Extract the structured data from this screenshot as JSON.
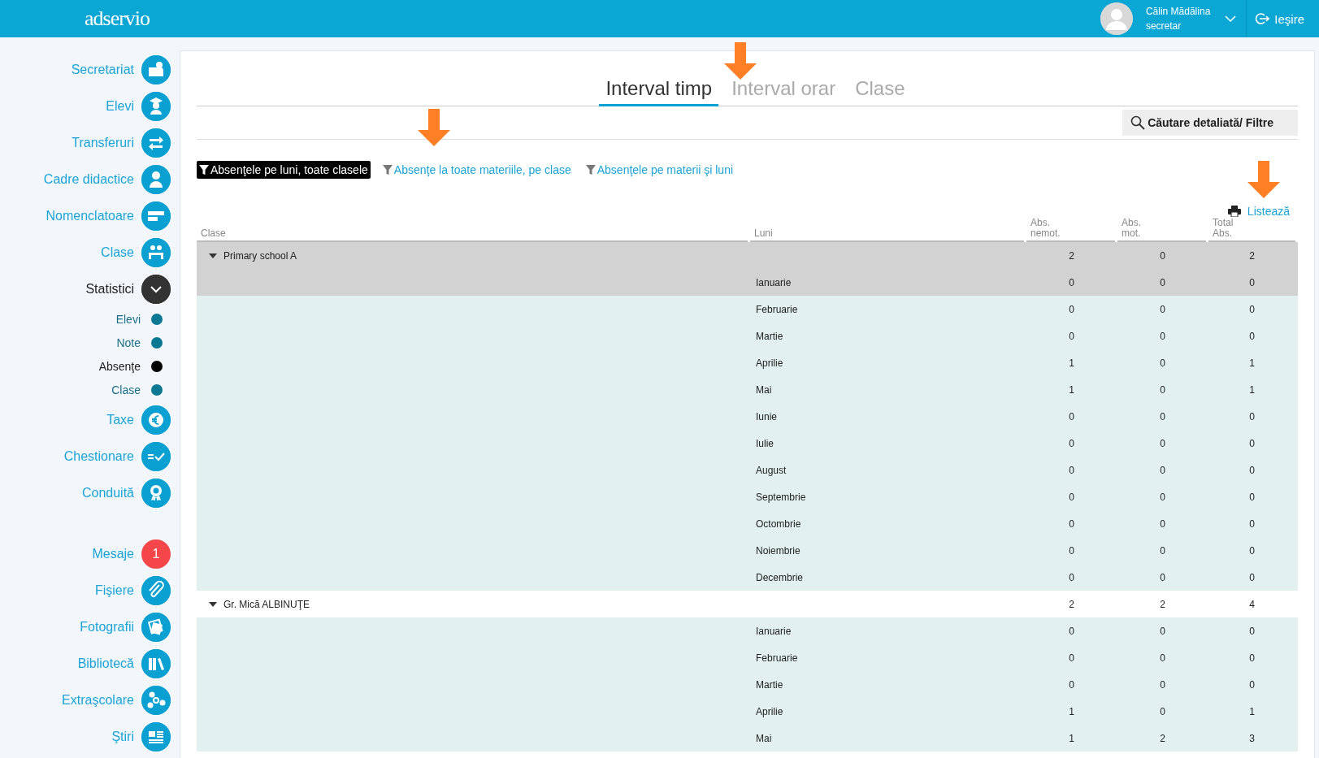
{
  "topbar": {
    "logo": "adservio",
    "user": {
      "name": "Călin Mădălina",
      "role": "secretar"
    },
    "logout": "Ieşire"
  },
  "sidebar": {
    "items": [
      {
        "label": "Secretariat",
        "kind": "icon",
        "selected": false
      },
      {
        "label": "Elevi",
        "kind": "icon",
        "selected": false
      },
      {
        "label": "Transferuri",
        "kind": "icon",
        "selected": false
      },
      {
        "label": "Cadre didactice",
        "kind": "icon",
        "selected": false
      },
      {
        "label": "Nomenclatoare",
        "kind": "icon",
        "selected": false
      },
      {
        "label": "Clase",
        "kind": "icon",
        "selected": false
      },
      {
        "label": "Statistici",
        "kind": "expand",
        "selected": true,
        "expanded": true,
        "children": [
          {
            "label": "Elevi",
            "selected": false
          },
          {
            "label": "Note",
            "selected": false
          },
          {
            "label": "Absenţe",
            "selected": true
          },
          {
            "label": "Clase",
            "selected": false
          }
        ]
      },
      {
        "label": "Taxe",
        "kind": "icon",
        "selected": false
      },
      {
        "label": "Chestionare",
        "kind": "icon",
        "selected": false
      },
      {
        "label": "Conduită",
        "kind": "icon",
        "selected": false
      },
      {
        "label": "Mesaje",
        "kind": "badge",
        "badge": "1",
        "selected": false
      },
      {
        "label": "Fişiere",
        "kind": "icon",
        "selected": false
      },
      {
        "label": "Fotografii",
        "kind": "icon",
        "selected": false
      },
      {
        "label": "Bibliotecă",
        "kind": "icon",
        "selected": false
      },
      {
        "label": "Extraşcolare",
        "kind": "icon",
        "selected": false
      },
      {
        "label": "Ştiri",
        "kind": "icon",
        "selected": false
      }
    ]
  },
  "tabs": [
    {
      "label": "Interval timp",
      "selected": true
    },
    {
      "label": "Interval orar",
      "selected": false
    },
    {
      "label": "Clase",
      "selected": false
    }
  ],
  "search_button": "Căutare detaliată/ Filtre",
  "filters": [
    {
      "label": "Absenţele pe luni, toate clasele",
      "selected": true
    },
    {
      "label": "Absenţe la toate materiile, pe clase",
      "selected": false
    },
    {
      "label": "Absenţele pe materii şi luni",
      "selected": false
    }
  ],
  "print_link": "Listează",
  "table": {
    "columns": [
      "Clase",
      "Luni",
      "Abs. nemot.",
      "Abs. mot.",
      "Total Abs."
    ],
    "rows": [
      {
        "clasa": "Primary school A",
        "expanded": true,
        "selected": true,
        "abs_nemot": "2",
        "abs_mot": "0",
        "total_abs": "2",
        "children": [
          {
            "luna": "Ianuarie",
            "selected": true,
            "abs_nemot": "0",
            "abs_mot": "0",
            "total_abs": "0"
          },
          {
            "luna": "Februarie",
            "selected": false,
            "abs_nemot": "0",
            "abs_mot": "0",
            "total_abs": "0"
          },
          {
            "luna": "Martie",
            "selected": false,
            "abs_nemot": "0",
            "abs_mot": "0",
            "total_abs": "0"
          },
          {
            "luna": "Aprilie",
            "selected": false,
            "abs_nemot": "1",
            "abs_mot": "0",
            "total_abs": "1"
          },
          {
            "luna": "Mai",
            "selected": false,
            "abs_nemot": "1",
            "abs_mot": "0",
            "total_abs": "1"
          },
          {
            "luna": "Iunie",
            "selected": false,
            "abs_nemot": "0",
            "abs_mot": "0",
            "total_abs": "0"
          },
          {
            "luna": "Iulie",
            "selected": false,
            "abs_nemot": "0",
            "abs_mot": "0",
            "total_abs": "0"
          },
          {
            "luna": "August",
            "selected": false,
            "abs_nemot": "0",
            "abs_mot": "0",
            "total_abs": "0"
          },
          {
            "luna": "Septembrie",
            "selected": false,
            "abs_nemot": "0",
            "abs_mot": "0",
            "total_abs": "0"
          },
          {
            "luna": "Octombrie",
            "selected": false,
            "abs_nemot": "0",
            "abs_mot": "0",
            "total_abs": "0"
          },
          {
            "luna": "Noiembrie",
            "selected": false,
            "abs_nemot": "0",
            "abs_mot": "0",
            "total_abs": "0"
          },
          {
            "luna": "Decembrie",
            "selected": false,
            "abs_nemot": "0",
            "abs_mot": "0",
            "total_abs": "0"
          }
        ]
      },
      {
        "clasa": "Gr. Mică ALBINUŢE",
        "expanded": true,
        "selected": false,
        "abs_nemot": "2",
        "abs_mot": "2",
        "total_abs": "4",
        "children": [
          {
            "luna": "Ianuarie",
            "selected": false,
            "abs_nemot": "0",
            "abs_mot": "0",
            "total_abs": "0"
          },
          {
            "luna": "Februarie",
            "selected": false,
            "abs_nemot": "0",
            "abs_mot": "0",
            "total_abs": "0"
          },
          {
            "luna": "Martie",
            "selected": false,
            "abs_nemot": "0",
            "abs_mot": "0",
            "total_abs": "0"
          },
          {
            "luna": "Aprilie",
            "selected": false,
            "abs_nemot": "1",
            "abs_mot": "0",
            "total_abs": "1"
          },
          {
            "luna": "Mai",
            "selected": false,
            "abs_nemot": "1",
            "abs_mot": "2",
            "total_abs": "3"
          }
        ]
      }
    ]
  }
}
